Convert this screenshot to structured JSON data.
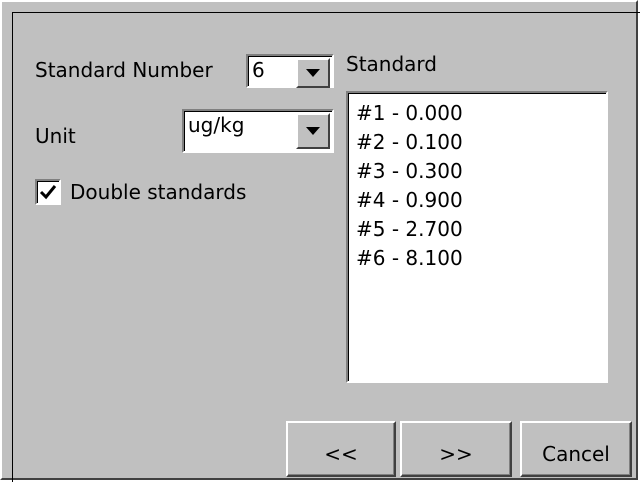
{
  "form": {
    "standard_number_label": "Standard Number",
    "standard_number_value": "6",
    "unit_label": "Unit",
    "unit_value": "ug/kg",
    "double_standards_label": "Double standards",
    "double_standards_checked": true
  },
  "standard_list": {
    "label": "Standard",
    "items": [
      "#1 - 0.000",
      "#2 - 0.100",
      "#3 - 0.300",
      "#4 - 0.900",
      "#5 - 2.700",
      "#6 - 8.100"
    ]
  },
  "buttons": {
    "back_label": "<<",
    "next_label": ">>",
    "cancel_label": "Cancel"
  },
  "icons": {
    "dropdown": "chevron-down-icon",
    "checkbox": "checkmark-icon"
  },
  "colors": {
    "face": "#c0c0c0",
    "field": "#ffffff",
    "text": "#000000"
  }
}
